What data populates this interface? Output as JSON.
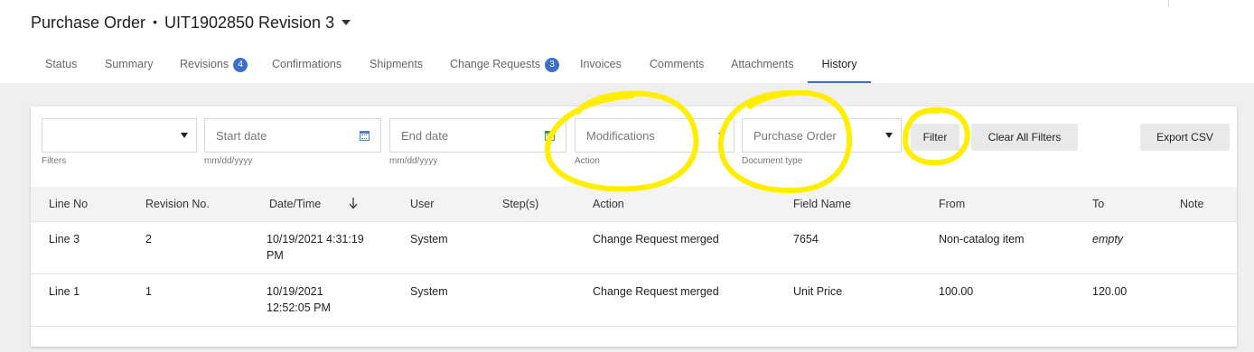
{
  "header": {
    "title": "Purchase Order",
    "separator": "•",
    "document": "UIT1902850 Revision 3"
  },
  "tabs": [
    {
      "label": "Status"
    },
    {
      "label": "Summary"
    },
    {
      "label": "Revisions",
      "badge": "4"
    },
    {
      "label": "Confirmations"
    },
    {
      "label": "Shipments"
    },
    {
      "label": "Change Requests",
      "badge": "3"
    },
    {
      "label": "Invoices"
    },
    {
      "label": "Comments"
    },
    {
      "label": "Attachments"
    },
    {
      "label": "History",
      "active": true
    }
  ],
  "filters": {
    "filters_select": {
      "value": "",
      "hint": "Filters"
    },
    "start_date": {
      "placeholder": "Start date",
      "hint": "mm/dd/yyyy"
    },
    "end_date": {
      "placeholder": "End date",
      "hint": "mm/dd/yyyy"
    },
    "action_select": {
      "value": "Modifications",
      "hint": "Action"
    },
    "document_type_select": {
      "value": "Purchase Order",
      "hint": "Document type"
    },
    "filter_button": "Filter",
    "clear_button": "Clear All Filters",
    "export_button": "Export CSV"
  },
  "table": {
    "columns": [
      "Line No",
      "Revision No.",
      "Date/Time",
      "User",
      "Step(s)",
      "Action",
      "Field Name",
      "From",
      "To",
      "Note"
    ],
    "rows": [
      {
        "line_no": "Line 3",
        "revision": "2",
        "datetime_1": "10/19/2021 4:31:19",
        "datetime_2": "PM",
        "user": "System",
        "steps": "",
        "action": "Change Request merged",
        "field": "7654",
        "from": "Non-catalog item",
        "to": "empty",
        "note": ""
      },
      {
        "line_no": "Line 1",
        "revision": "1",
        "datetime_1": "10/19/2021",
        "datetime_2": "12:52:05 PM",
        "user": "System",
        "steps": "",
        "action": "Change Request merged",
        "field": "Unit Price",
        "from": "100.00",
        "to": "120.00",
        "note": ""
      }
    ]
  },
  "colors": {
    "accent": "#3b6fc9",
    "highlight_annotation": "#ffee00"
  }
}
